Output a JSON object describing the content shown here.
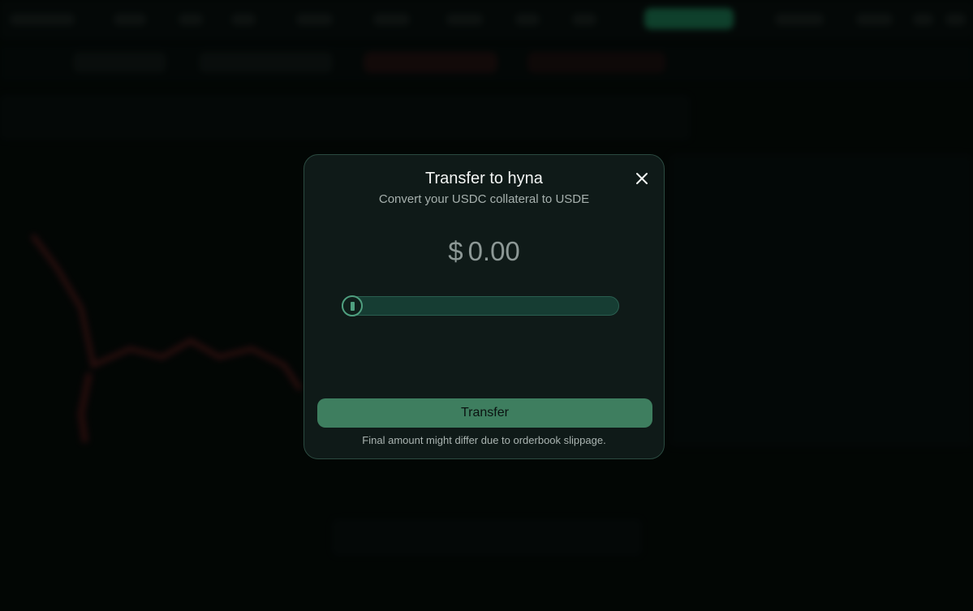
{
  "modal": {
    "title": "Transfer to hyna",
    "subtitle": "Convert your USDC collateral to USDE",
    "amount": {
      "currency_symbol": "$",
      "value": "0.00"
    },
    "slider": {
      "value_fraction": 0
    },
    "transfer_button_label": "Transfer",
    "footnote": "Final amount might differ due to orderbook slippage.",
    "close_icon": "close-icon"
  },
  "colors": {
    "accent": "#3e7e5f",
    "modal_border": "#2b4a40",
    "modal_bg": "#0f1a18",
    "background": "#050b09"
  }
}
